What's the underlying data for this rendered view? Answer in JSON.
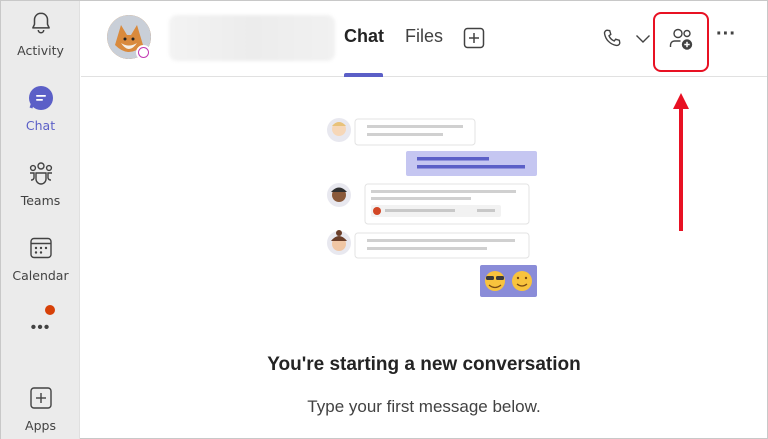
{
  "rail": {
    "items": [
      {
        "label": "Activity",
        "icon": "bell-icon"
      },
      {
        "label": "Chat",
        "icon": "chat-icon"
      },
      {
        "label": "Teams",
        "icon": "teams-icon"
      },
      {
        "label": "Calendar",
        "icon": "calendar-icon"
      },
      {
        "label": "Apps",
        "icon": "plus-square-icon"
      }
    ],
    "more_label": "•••",
    "active": "Chat"
  },
  "header": {
    "tabs": [
      {
        "label": "Chat"
      },
      {
        "label": "Files"
      }
    ],
    "more_label": "···"
  },
  "empty_state": {
    "title": "You're starting a new conversation",
    "subtitle": "Type your first message below."
  },
  "colors": {
    "brand": "#5b5fc7",
    "rail_bg": "#ebebeb",
    "notification": "#d74108",
    "annotation_red": "#e81123"
  }
}
